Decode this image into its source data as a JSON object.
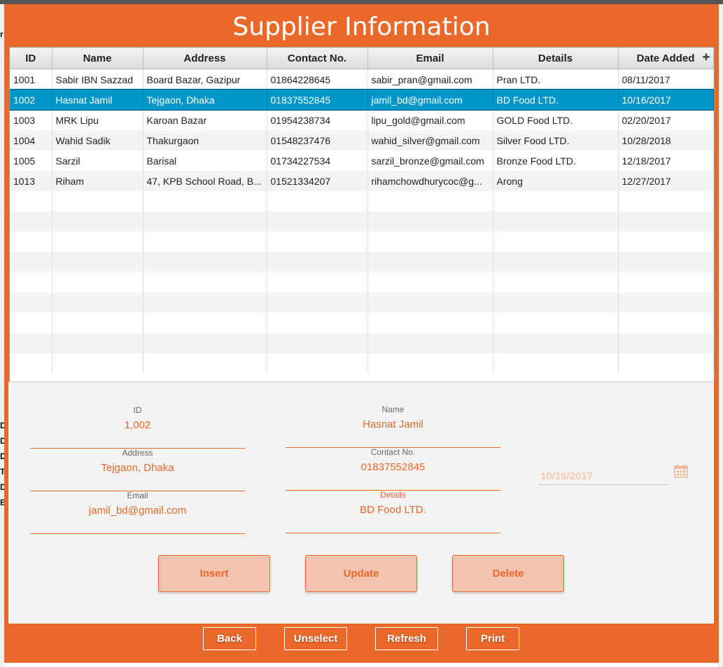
{
  "window": {
    "title": "Supplier Information"
  },
  "table": {
    "columns": [
      "ID",
      "Name",
      "Address",
      "Contact No.",
      "Email",
      "Details",
      "Date Added"
    ],
    "rows": [
      [
        "1001",
        "Sabir IBN Sazzad",
        "Board Bazar, Gazipur",
        "01864228645",
        "sabir_pran@gmail.com",
        "Pran LTD.",
        "08/11/2017"
      ],
      [
        "1002",
        "Hasnat Jamil",
        "Tejgaon, Dhaka",
        "01837552845",
        "jamil_bd@gmail.com",
        "BD Food LTD.",
        "10/16/2017"
      ],
      [
        "1003",
        "MRK Lipu",
        "Karoan Bazar",
        "01954238734",
        "lipu_gold@gmail.com",
        "GOLD Food LTD.",
        "02/20/2017"
      ],
      [
        "1004",
        "Wahid Sadik",
        "Thakurgaon",
        "01548237476",
        "wahid_silver@gmail.com",
        "Silver Food LTD.",
        "10/28/2018"
      ],
      [
        "1005",
        "Sarzil",
        "Barisal",
        "01734227534",
        "sarzil_bronze@gmail.com",
        "Bronze Food LTD.",
        "12/18/2017"
      ],
      [
        "1013",
        "Riham",
        "47, KPB School Road, B...",
        "01521334207",
        "rihamchowdhurycoc@g...",
        "Arong",
        "12/27/2017"
      ]
    ],
    "selected_row": 1,
    "column_menu_icon": "plus-icon"
  },
  "form": {
    "id": {
      "label": "ID",
      "value": "1,002"
    },
    "name": {
      "label": "Name",
      "value": "Hasnat Jamil"
    },
    "address": {
      "label": "Address",
      "value": "Tejgaon, Dhaka"
    },
    "contact": {
      "label": "Contact No.",
      "value": "01837552845"
    },
    "email": {
      "label": "Email",
      "value": "jamil_bd@gmail.com"
    },
    "details": {
      "label": "Details",
      "value": "BD Food LTD."
    },
    "date": {
      "value": "10/16/2017",
      "icon": "calendar-icon"
    }
  },
  "actions": {
    "insert": "Insert",
    "update": "Update",
    "delete": "Delete"
  },
  "nav": {
    "back": "Back",
    "unselect": "Unselect",
    "refresh": "Refresh",
    "print": "Print"
  },
  "background_window": {
    "letters": [
      "r",
      "D",
      "D",
      "D",
      "T",
      "D",
      "B"
    ]
  },
  "colors": {
    "accent": "#e9682a",
    "selection": "#0096c9",
    "button_fill": "#f2c4b0",
    "panel": "#f3f3f3"
  }
}
